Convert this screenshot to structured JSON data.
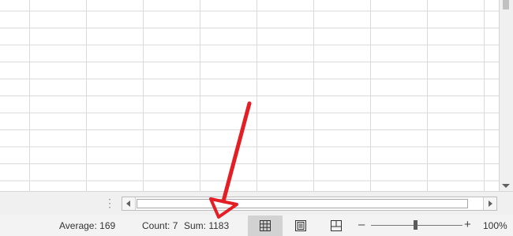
{
  "status_bar": {
    "average": "Average: 169",
    "count": "Count: 7",
    "sum": "Sum: 1183",
    "zoom_level": "100%",
    "zoom_minus": "–",
    "zoom_plus": "+",
    "zoom_fraction": 0.5
  },
  "scrollbar": {
    "split_handle": "⋮"
  },
  "view_buttons": [
    {
      "name": "normal-view",
      "icon": "grid-icon",
      "active": true
    },
    {
      "name": "page-layout-view",
      "icon": "page-layout-icon",
      "active": false
    },
    {
      "name": "page-break-preview",
      "icon": "page-break-icon",
      "active": false
    }
  ],
  "colors": {
    "arrow": "#e31e24",
    "gridline": "#dadada",
    "status_background": "#f3f3f3"
  }
}
